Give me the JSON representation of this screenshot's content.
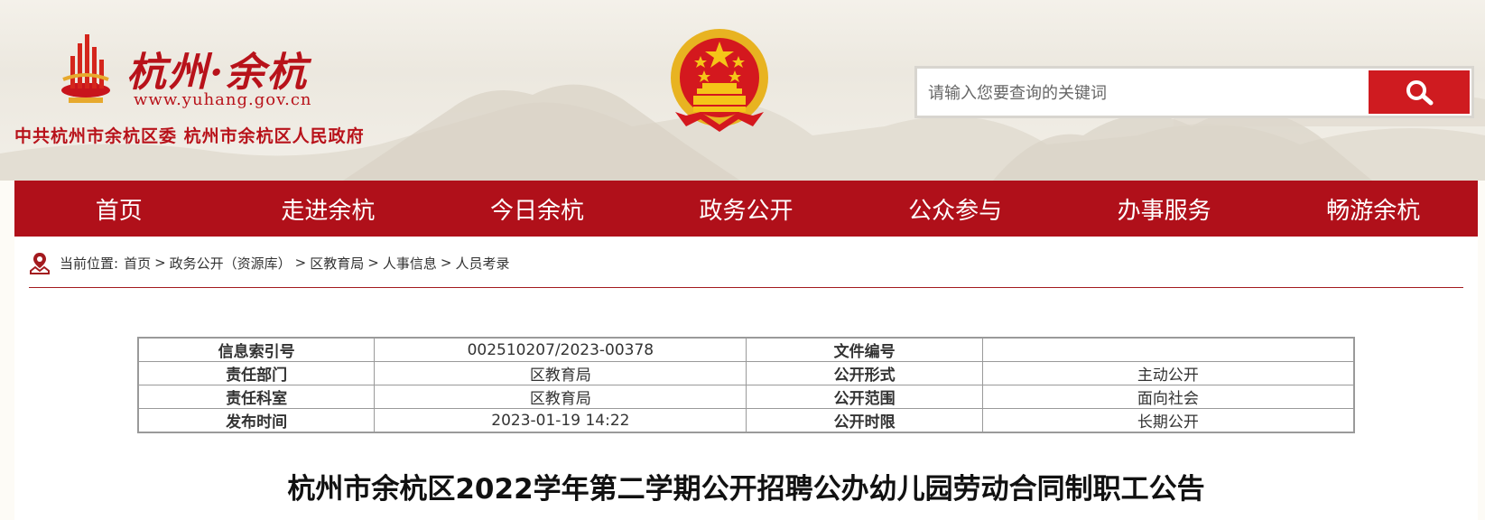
{
  "header": {
    "logo_title": "杭州·余杭",
    "logo_url": "www.yuhang.gov.cn",
    "org_name": "中共杭州市余杭区委 杭州市余杭区人民政府"
  },
  "search": {
    "placeholder": "请输入您要查询的关键词",
    "value": ""
  },
  "nav": {
    "items": [
      "首页",
      "走进余杭",
      "今日余杭",
      "政务公开",
      "公众参与",
      "办事服务",
      "畅游余杭"
    ]
  },
  "breadcrumb": {
    "prefix": "当前位置:",
    "items": [
      "首页",
      "政务公开（资源库）",
      "区教育局",
      "人事信息",
      "人员考录"
    ],
    "separator": ">"
  },
  "meta_table": {
    "rows": [
      {
        "k1": "信息索引号",
        "v1": "002510207/2023-00378",
        "k2": "文件编号",
        "v2": ""
      },
      {
        "k1": "责任部门",
        "v1": "区教育局",
        "k2": "公开形式",
        "v2": "主动公开"
      },
      {
        "k1": "责任科室",
        "v1": "区教育局",
        "k2": "公开范围",
        "v2": "面向社会"
      },
      {
        "k1": "发布时间",
        "v1": "2023-01-19 14:22",
        "k2": "公开时限",
        "v2": "长期公开"
      }
    ]
  },
  "article": {
    "title": "杭州市余杭区2022学年第二学期公开招聘公办幼儿园劳动合同制职工公告"
  },
  "icons": {
    "logo": "yuhang-logo-icon",
    "emblem": "national-emblem-icon",
    "search": "search-icon",
    "location": "map-location-icon"
  },
  "colors": {
    "brand_red": "#b0101a",
    "search_red": "#cf1b20",
    "emblem_gold": "#e8b321"
  }
}
